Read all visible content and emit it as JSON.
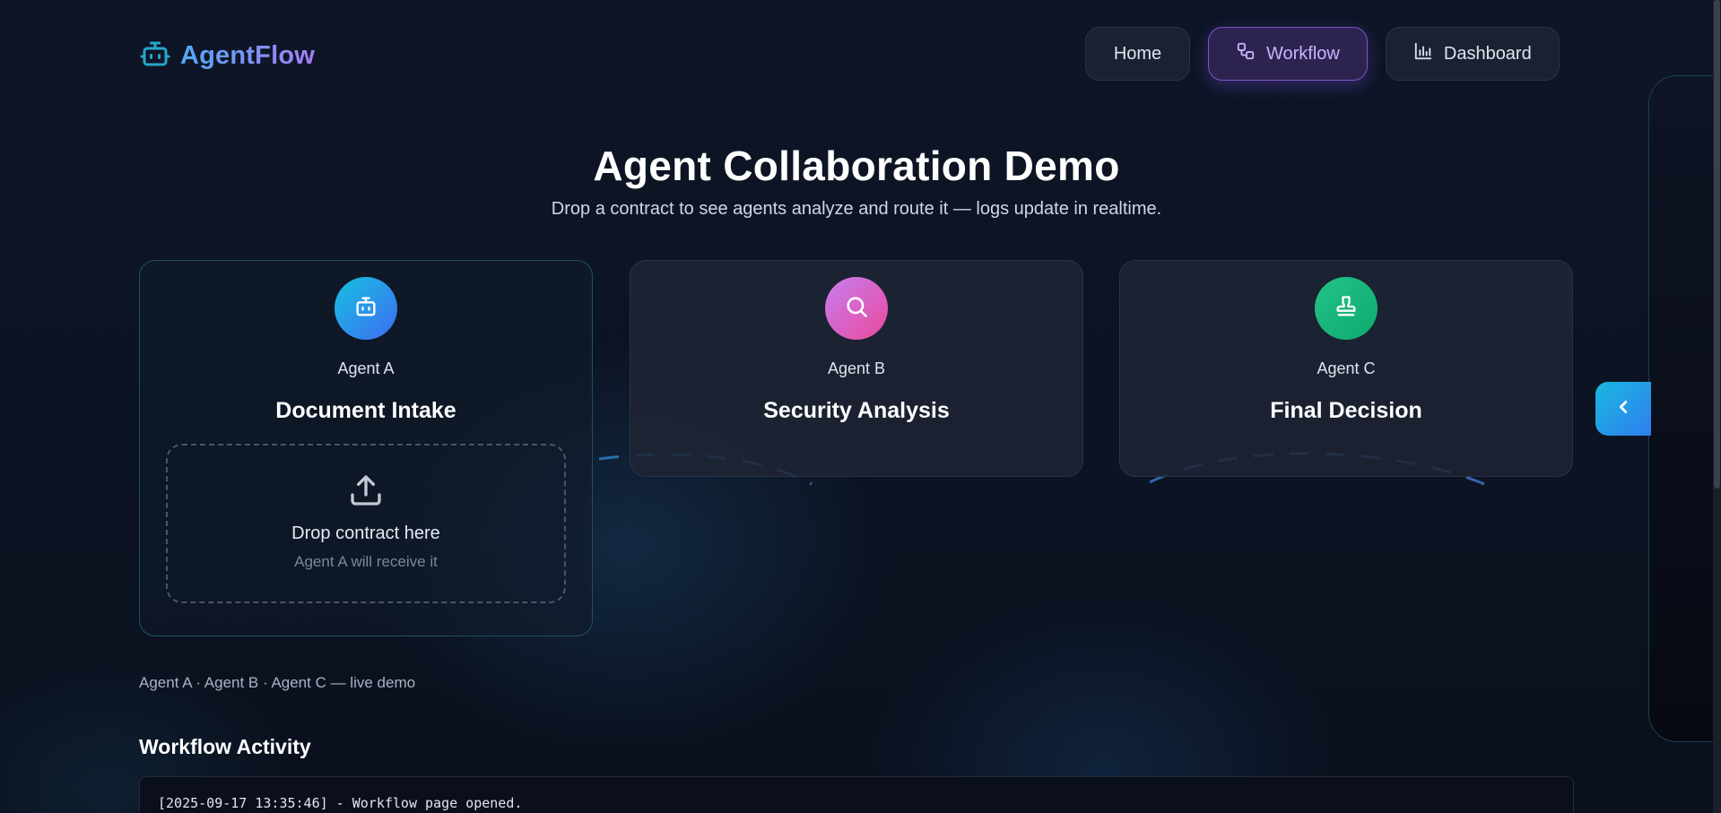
{
  "app": {
    "logo_text": "AgentFlow",
    "logo_icon": "robot-icon"
  },
  "nav": {
    "home": "Home",
    "workflow": "Workflow",
    "dashboard": "Dashboard",
    "active": "Workflow"
  },
  "hero": {
    "title": "Agent Collaboration Demo",
    "subtitle": "Drop a contract to see agents analyze and route it — logs update in realtime."
  },
  "agents": [
    {
      "label": "Agent A",
      "title": "Document Intake",
      "icon": "robot-icon",
      "color": "#18c1e0"
    },
    {
      "label": "Agent B",
      "title": "Security Analysis",
      "icon": "search-icon",
      "color": "#d464c4"
    },
    {
      "label": "Agent C",
      "title": "Final Decision",
      "icon": "stamp-icon",
      "color": "#1fbf86"
    }
  ],
  "dropzone": {
    "title": "Drop contract here",
    "subtitle": "Agent A will receive it",
    "icon": "upload-icon"
  },
  "demo_note": "Agent A · Agent B · Agent C — live demo",
  "activity": {
    "title": "Workflow Activity",
    "logs": [
      "[2025-09-17 13:35:46] - Workflow page opened."
    ]
  },
  "side_panel": {
    "toggle_icon": "chevron-left-icon"
  },
  "colors": {
    "accent_purple": "#a57ef5",
    "accent_blue": "#52a8f5",
    "background": "#0d1424"
  }
}
